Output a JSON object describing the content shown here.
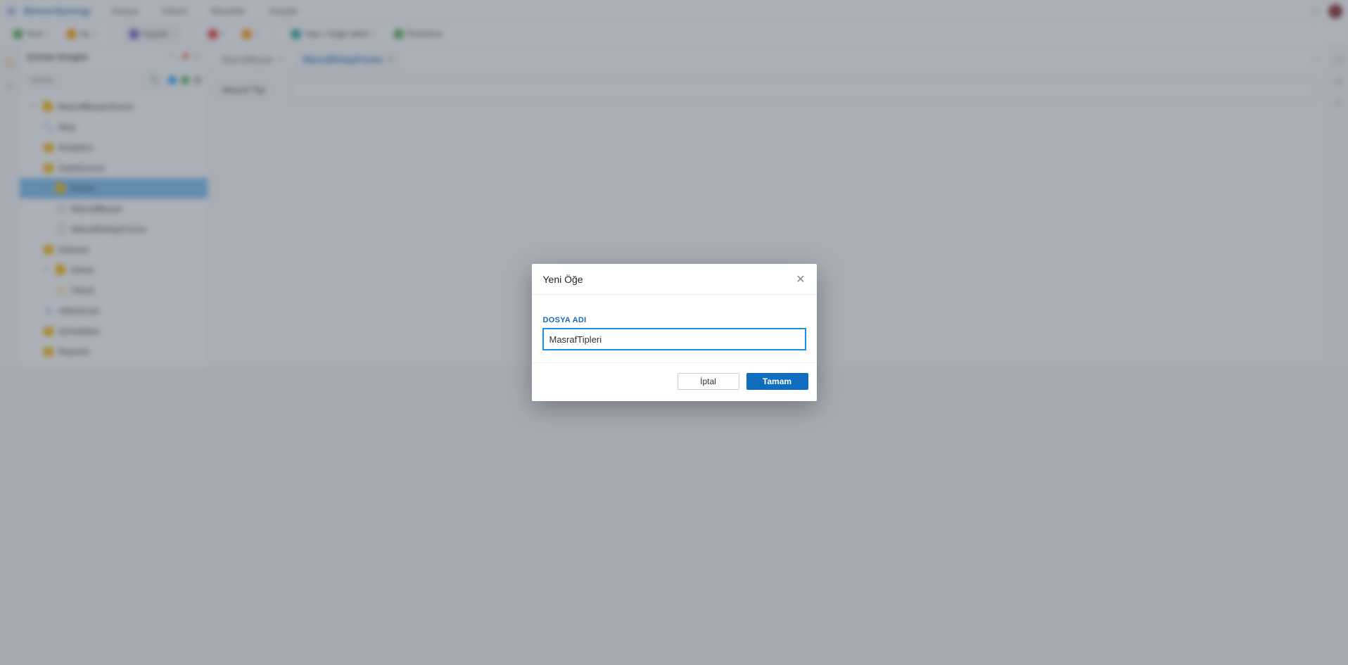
{
  "brand": "BimserSynergy",
  "top_menu": [
    "Dosya",
    "Görün",
    "Ekranlar",
    "Araçlar"
  ],
  "toolbar": {
    "new_label": "Yeni",
    "open_label": "Aç",
    "save_label": "Kaydet",
    "deploy_label": "Yapı / Dağıt aktör",
    "preview_label": "Önizleme"
  },
  "sidebar": {
    "title": "Çözüm Gezgini",
    "search_placeholder": "Arama",
    "items": [
      {
        "label": "MasrafBeyanSureci",
        "icon": "folder-open",
        "level": 0
      },
      {
        "label": "Akış",
        "icon": "flow",
        "level": 1
      },
      {
        "label": "Analytics",
        "icon": "folder",
        "level": 1
      },
      {
        "label": "DataSource",
        "icon": "folder",
        "level": 1
      },
      {
        "label": "Forms",
        "icon": "folder",
        "level": 1,
        "selected": true
      },
      {
        "label": "MasrafBeyan",
        "icon": "file",
        "level": 2
      },
      {
        "label": "MasrafDetayFormu",
        "icon": "file",
        "level": 2
      },
      {
        "label": "Indexes",
        "icon": "folder",
        "level": 1
      },
      {
        "label": "Views",
        "icon": "folder",
        "level": 1
      },
      {
        "label": "View1",
        "icon": "view",
        "level": 2
      },
      {
        "label": "references",
        "icon": "ref",
        "level": 1
      },
      {
        "label": "Schedules",
        "icon": "folder",
        "level": 1
      },
      {
        "label": "Reports",
        "icon": "folder",
        "level": 1
      }
    ]
  },
  "tabs": [
    {
      "label": "MasrafBeyan",
      "active": false
    },
    {
      "label": "MasrafDetayFormu",
      "active": true
    }
  ],
  "main_field_label": "Masraf Tipi",
  "modal": {
    "title": "Yeni Öğe",
    "field_label": "DOSYA ADI",
    "value": "MasrafTipleri",
    "cancel": "İptal",
    "ok": "Tamam"
  }
}
